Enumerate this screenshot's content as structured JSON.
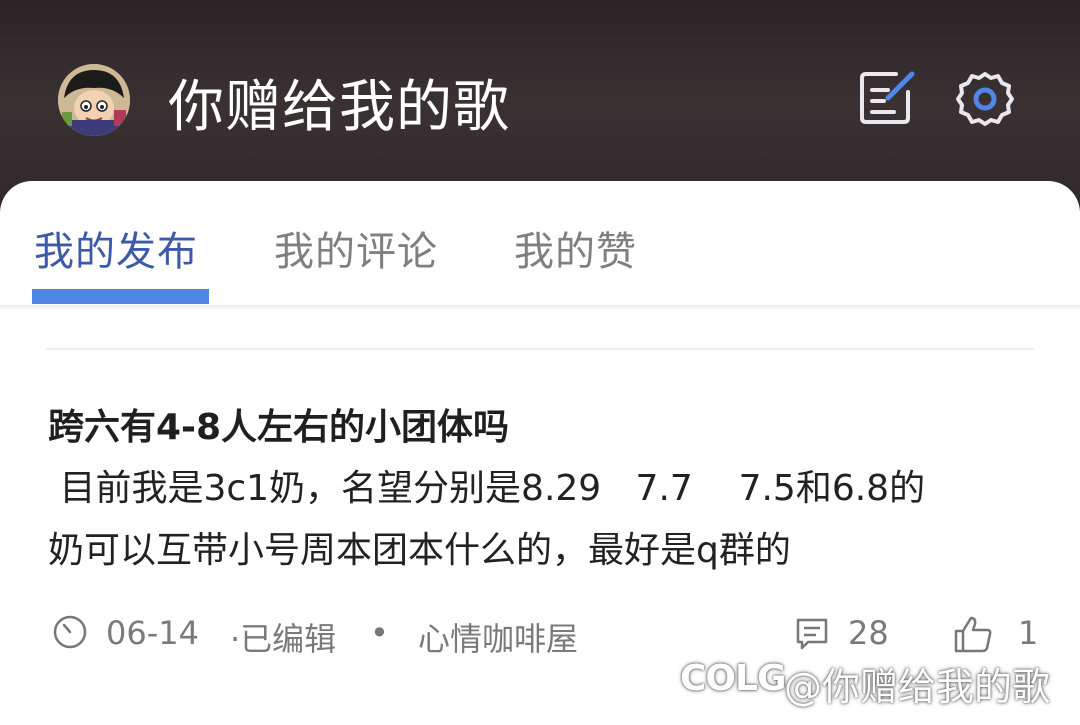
{
  "header": {
    "title": "你赠给我的歌",
    "avatar": "avatar",
    "edit_icon": "edit-icon",
    "settings_icon": "gear-icon"
  },
  "tabs": [
    {
      "label": "我的发布",
      "active": true
    },
    {
      "label": "我的评论",
      "active": false
    },
    {
      "label": "我的赞",
      "active": false
    }
  ],
  "post": {
    "title": "跨六有4-8人左右的小团体吗",
    "body": " 目前我是3c1奶，名望分别是8.29   7.7    7.5和6.8的\n奶可以互带小号周本团本什么的，最好是q群的",
    "date": "06-14",
    "edited": "·已编辑",
    "separator": "•",
    "topic": "心情咖啡屋",
    "comments": "28",
    "likes": "1"
  },
  "watermark": {
    "logo": "COLG",
    "text": "@你赠给我的歌"
  },
  "colors": {
    "accent_text": "#3c5aa7",
    "indicator": "#4f86e8",
    "header_bg": "#2f2729"
  }
}
